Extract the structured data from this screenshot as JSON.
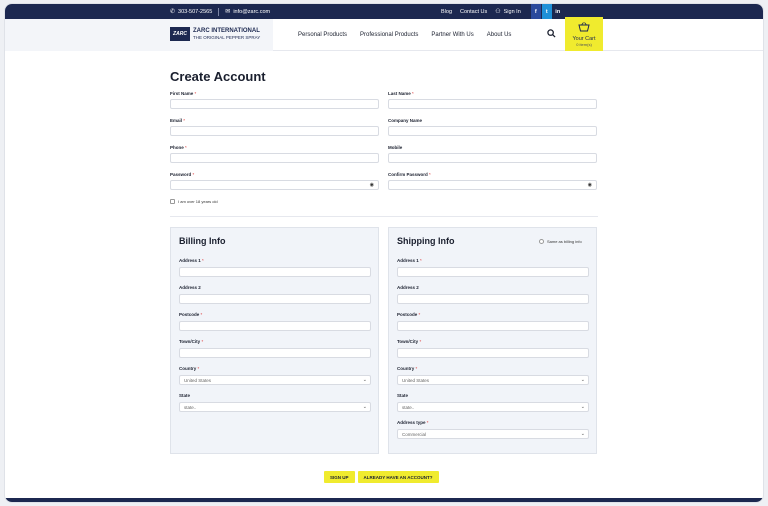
{
  "topbar": {
    "phone": "303-507-2565",
    "email": "info@zarc.com",
    "links": [
      "Blog",
      "Contact Us",
      "Sign In"
    ],
    "social": [
      "f",
      "t",
      "in"
    ]
  },
  "logo": {
    "mark": "ZARC",
    "name": "ZARC INTERNATIONAL",
    "tagline": "THE ORIGINAL PEPPER SPRAY"
  },
  "nav": [
    "Personal Products",
    "Professional Products",
    "Partner With Us",
    "About Us"
  ],
  "cart": {
    "label": "Your Cart",
    "count": "0 item(s)"
  },
  "page_title": "Create Account",
  "account_fields": {
    "first_name": "First Name",
    "last_name": "Last Name",
    "email": "Email",
    "company": "Company Name",
    "phone": "Phone",
    "mobile": "Mobile",
    "password": "Password",
    "confirm_password": "Confirm Password"
  },
  "age_check": "I am over 18 years old",
  "billing": {
    "title": "Billing Info",
    "address1": "Address 1",
    "address2": "Address 2",
    "postcode": "Postcode",
    "town": "Town/City",
    "country": "Country",
    "country_value": "United States",
    "state": "State",
    "state_value": "state.."
  },
  "shipping": {
    "title": "Shipping Info",
    "same_as_billing": "Same as billing info",
    "address1": "Address 1",
    "address2": "Address 2",
    "postcode": "Postcode",
    "town": "Town/City",
    "country": "Country",
    "country_value": "United States",
    "state": "State",
    "state_value": "state..",
    "address_type": "Address type",
    "address_type_value": "Commercial"
  },
  "buttons": {
    "signup": "SIGN UP",
    "have_account": "ALREADY HAVE AN ACCOUNT?"
  },
  "colors": {
    "navy": "#1c2850",
    "accent": "#f0eb2e",
    "required": "#d33333"
  },
  "icons": {
    "phone": "phone-icon",
    "email": "envelope-icon",
    "user": "user-icon",
    "search": "search-icon",
    "cart": "basket-icon",
    "eye": "eye-icon"
  }
}
